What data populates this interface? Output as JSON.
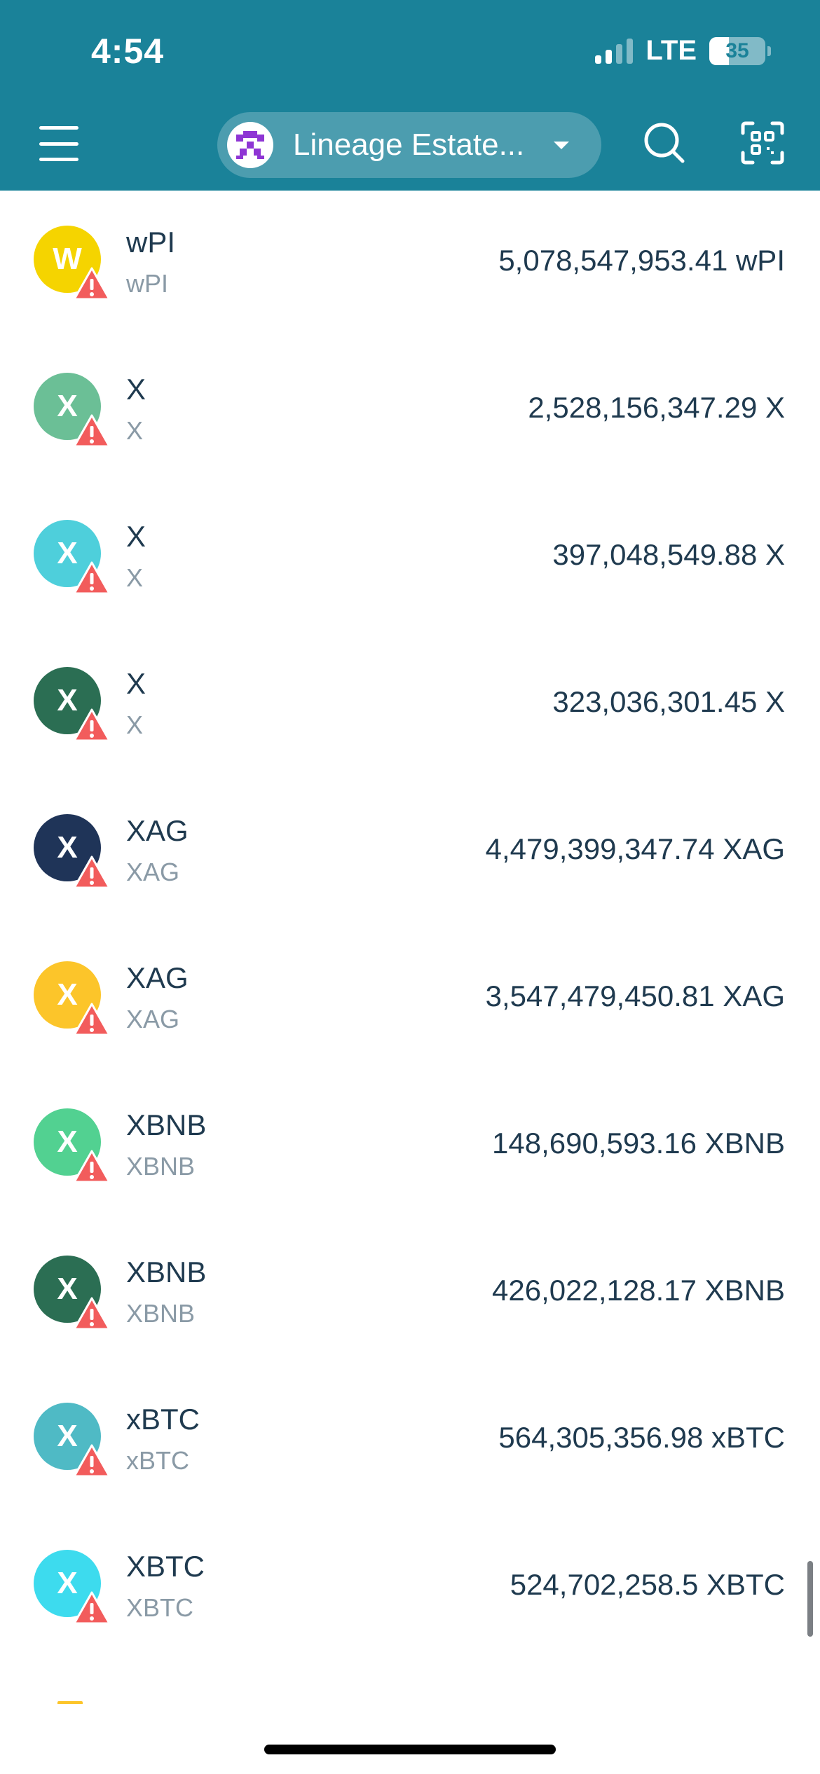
{
  "status_bar": {
    "time": "4:54",
    "network": "LTE",
    "battery_percent": "35",
    "battery_level": 0.35,
    "signal_bars_active": 2,
    "signal_bars_total": 4
  },
  "header": {
    "wallet_name": "Lineage Estate...",
    "accent_color": "#1a8299"
  },
  "tokens": [
    {
      "name": "wPI",
      "symbol": "wPI",
      "letter": "W",
      "balance": "5,078,547,953.41 wPI",
      "color": "#f5d400"
    },
    {
      "name": "X",
      "symbol": "X",
      "letter": "X",
      "balance": "2,528,156,347.29 X",
      "color": "#6bbf96"
    },
    {
      "name": "X",
      "symbol": "X",
      "letter": "X",
      "balance": "397,048,549.88 X",
      "color": "#4ecfdb"
    },
    {
      "name": "X",
      "symbol": "X",
      "letter": "X",
      "balance": "323,036,301.45 X",
      "color": "#2b6e53"
    },
    {
      "name": "XAG",
      "symbol": "XAG",
      "letter": "X",
      "balance": "4,479,399,347.74 XAG",
      "color": "#1f3458"
    },
    {
      "name": "XAG",
      "symbol": "XAG",
      "letter": "X",
      "balance": "3,547,479,450.81 XAG",
      "color": "#fcc52a"
    },
    {
      "name": "XBNB",
      "symbol": "XBNB",
      "letter": "X",
      "balance": "148,690,593.16 XBNB",
      "color": "#52d191"
    },
    {
      "name": "XBNB",
      "symbol": "XBNB",
      "letter": "X",
      "balance": "426,022,128.17 XBNB",
      "color": "#2b6e53"
    },
    {
      "name": "xBTC",
      "symbol": "xBTC",
      "letter": "X",
      "balance": "564,305,356.98 xBTC",
      "color": "#4fbac5"
    },
    {
      "name": "XBTC",
      "symbol": "XBTC",
      "letter": "X",
      "balance": "524,702,258.5 XBTC",
      "color": "#3ddbee"
    }
  ],
  "icons": {
    "menu": "hamburger-icon",
    "search": "search-icon",
    "scan": "qr-scan-icon",
    "warning": "warning-icon",
    "dropdown": "chevron-down-icon"
  },
  "colors": {
    "warning": "#f25c5c",
    "text_primary": "#1f3a4f",
    "text_secondary": "#8a9aa6",
    "partial_row_icon": "#fcc52a"
  }
}
